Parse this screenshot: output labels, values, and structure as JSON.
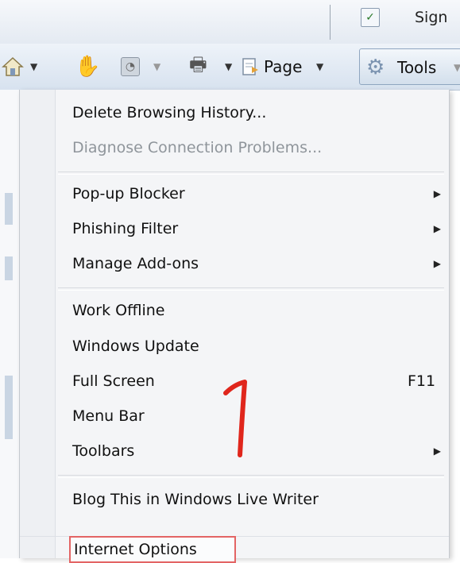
{
  "topbar": {
    "sign_label": "Sign",
    "spell_icon": "spellcheck-icon"
  },
  "toolbar": {
    "page_label": "Page",
    "tools_label": "Tools",
    "icons": [
      "home-icon",
      "hand-icon",
      "feed-icon",
      "print-icon",
      "page-icon",
      "gear-icon"
    ]
  },
  "menu": {
    "items": [
      {
        "label": "Delete Browsing History...",
        "enabled": true
      },
      {
        "label": "Diagnose Connection Problems...",
        "enabled": false
      },
      {
        "label": "Pop-up Blocker",
        "submenu": true
      },
      {
        "label": "Phishing Filter",
        "submenu": true
      },
      {
        "label": "Manage Add-ons",
        "submenu": true
      },
      {
        "label": "Work Offline"
      },
      {
        "label": "Windows Update"
      },
      {
        "label": "Full Screen",
        "shortcut": "F11"
      },
      {
        "label": "Menu Bar"
      },
      {
        "label": "Toolbars",
        "submenu": true
      },
      {
        "label": "Blog This in Windows Live Writer"
      },
      {
        "label": "Internet Options",
        "highlighted": true
      }
    ]
  },
  "annotation": {
    "number": "1",
    "color": "#e0261c"
  },
  "colors": {
    "highlight_border": "#e36464"
  }
}
